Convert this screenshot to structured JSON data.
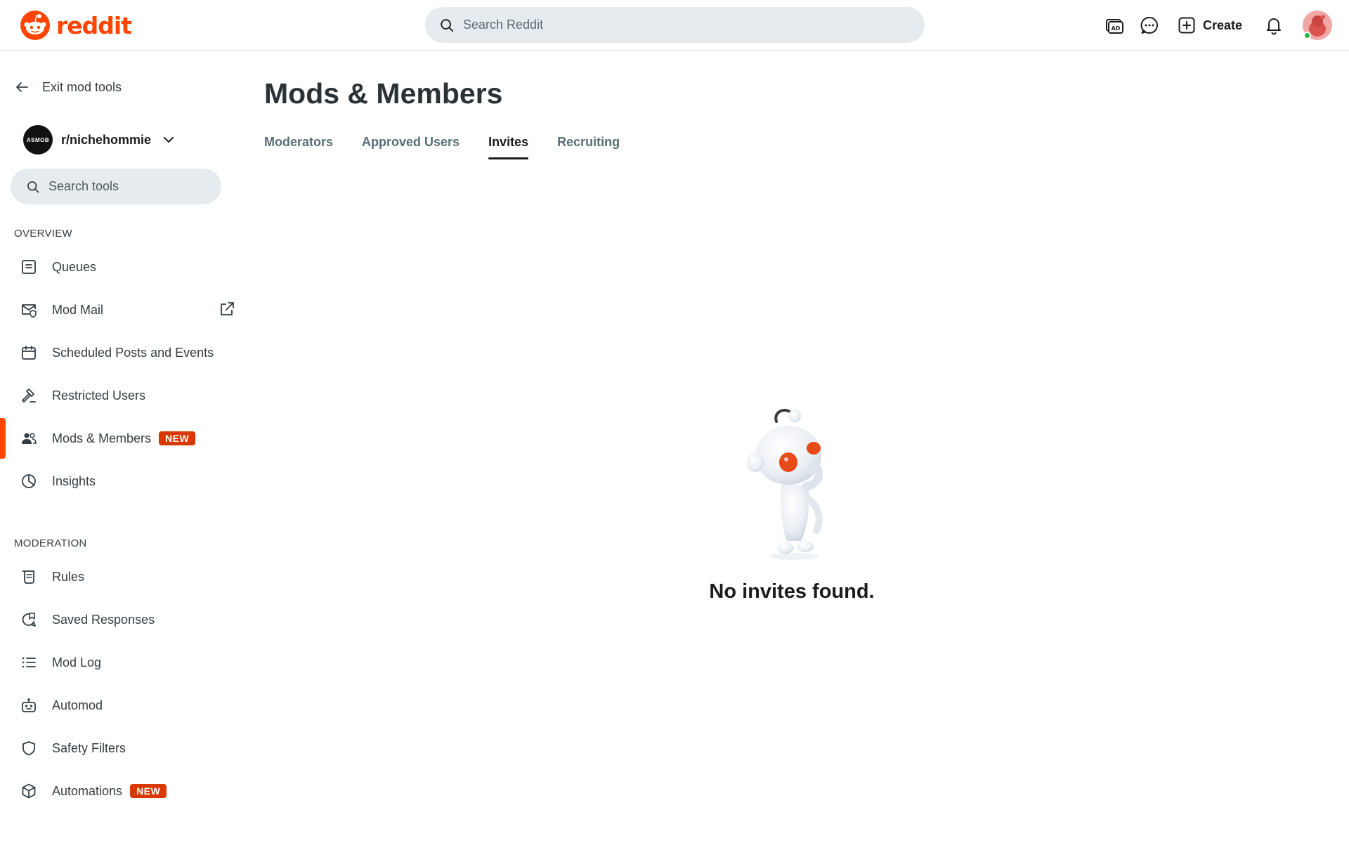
{
  "header": {
    "logo_text": "reddit",
    "search_placeholder": "Search Reddit",
    "create_label": "Create",
    "brand_color": "#ff4500"
  },
  "sidebar": {
    "exit_label": "Exit mod tools",
    "community": {
      "name": "r/nichehommie",
      "avatar_text": "ASMOB"
    },
    "tool_search_placeholder": "Search tools",
    "sections": [
      {
        "label": "OVERVIEW",
        "items": [
          {
            "label": "Queues",
            "icon": "queue-icon"
          },
          {
            "label": "Mod Mail",
            "icon": "mod-mail-icon",
            "external": true
          },
          {
            "label": "Scheduled Posts and Events",
            "icon": "calendar-icon"
          },
          {
            "label": "Restricted Users",
            "icon": "hammer-icon"
          },
          {
            "label": "Mods & Members",
            "icon": "members-icon",
            "badge": "NEW",
            "active": true
          },
          {
            "label": "Insights",
            "icon": "pie-chart-icon"
          }
        ]
      },
      {
        "label": "MODERATION",
        "items": [
          {
            "label": "Rules",
            "icon": "rules-icon"
          },
          {
            "label": "Saved Responses",
            "icon": "saved-responses-icon"
          },
          {
            "label": "Mod Log",
            "icon": "list-icon"
          },
          {
            "label": "Automod",
            "icon": "robot-icon"
          },
          {
            "label": "Safety Filters",
            "icon": "shield-icon"
          },
          {
            "label": "Automations",
            "icon": "cube-icon",
            "badge": "NEW"
          }
        ]
      }
    ],
    "badge_color": "#d93900"
  },
  "main": {
    "title": "Mods & Members",
    "tabs": [
      {
        "label": "Moderators",
        "active": false
      },
      {
        "label": "Approved Users",
        "active": false
      },
      {
        "label": "Invites",
        "active": true
      },
      {
        "label": "Recruiting",
        "active": false
      }
    ],
    "empty_message": "No invites found."
  }
}
